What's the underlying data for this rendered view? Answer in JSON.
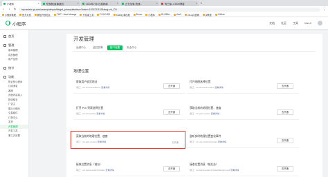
{
  "browser": {
    "tabs": [
      {
        "label": "小程序",
        "active": true
      },
      {
        "label": "短视频|直播|图文",
        "active": false
      },
      {
        "label": "2022年7月1日起新增",
        "active": false
      },
      {
        "label": "正在加载-快速...",
        "active": false
      },
      {
        "label": "有已保 -CSDN博客",
        "active": false
      }
    ],
    "url": "mp.weixin.qq.com/wxamp/devprofile/get_privacyinterface?token=1576721102&lang=zh_CN"
  },
  "bookmarks": [
    "小程序管理",
    "官方文档",
    "微信开放社区",
    "TINT - Next Mesage",
    "开发者工具",
    "FOXO API",
    "Dialog 弹出框",
    "Demo",
    "小程序",
    "GLOBAL",
    "Vue3",
    "uni-app官网",
    "js教程",
    "GitHub"
  ],
  "header": {
    "logo_label": "小程序",
    "nav": [
      "文档",
      "社区",
      "工具",
      "WeUI"
    ]
  },
  "sidebar": {
    "groups": [
      {
        "label": "首页",
        "items": []
      },
      {
        "label": "管理",
        "items": [
          "版本管理",
          "成员管理",
          "用户反馈"
        ]
      },
      {
        "label": "统计",
        "items": []
      },
      {
        "label": "功能",
        "items": [
          "附近的小程序",
          "订阅消息",
          "客服",
          "页面内容接入",
          "物流助手",
          "广告主",
          "展示小程序",
          "交易组件",
          "订单中心",
          "发货",
          "开发管理",
          "开发工具",
          "第三方设置"
        ]
      }
    ]
  },
  "page": {
    "title": "开发管理",
    "tabs": [
      "运维中心",
      "监控告警",
      "接口设置",
      "安全中心"
    ],
    "section": "地理位置"
  },
  "apis": [
    {
      "name": "获取用户收货地址",
      "desc": "接口：wx.chooseAddress",
      "link": "查看详情",
      "action": "去开通",
      "status": ""
    },
    {
      "name": "打开地图选择位置",
      "desc": "接口：wx.chooseLocation",
      "link": "查看详情",
      "action": "去开通",
      "status": ""
    },
    {
      "name": "打开 POI 列表选择位置",
      "desc": "接口：wx.choosePoi",
      "link": "查看详情",
      "action": "去开通",
      "status": ""
    },
    {
      "name": "获取当前的地理位置、速度",
      "desc": "接口：wx.getLocation",
      "link": "查看详情",
      "action": "去开通",
      "status": ""
    },
    {
      "name": "获取当前的地理位置、速度",
      "desc": "接口：wx.getLocation",
      "link": "查看详情",
      "action": "",
      "status": "已开通"
    },
    {
      "name": "监听实时地理位置变化事件",
      "desc": "接口：wx.onLocationChange",
      "link": "查看详情",
      "action": "去开通",
      "status": ""
    },
    {
      "name": "接收位置消息（前台）",
      "desc": "接口：wx.startLocationUpdate",
      "link": "查看详情",
      "action": "去开通",
      "status": ""
    },
    {
      "name": "接收位置消息（前后台）",
      "desc": "接口：wx.startLocationUpdateBackground",
      "link": "查看详情",
      "action": "去开通",
      "status": ""
    }
  ],
  "colors": {
    "accent": "#07c160",
    "highlight": "#e0362b",
    "link": "#576b95"
  }
}
